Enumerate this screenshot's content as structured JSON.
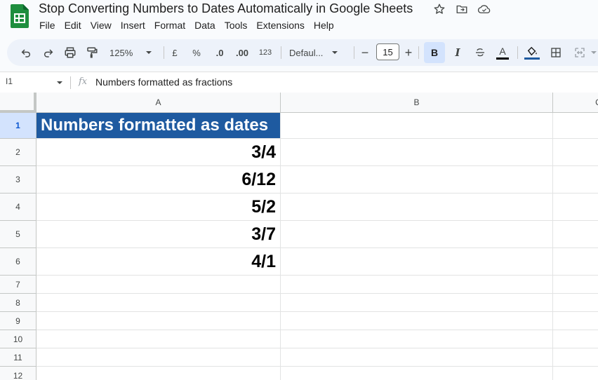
{
  "app": {
    "doc_title": "Stop Converting Numbers to Dates Automatically in Google Sheets",
    "brand_color": "#1e8e3e"
  },
  "menu": [
    "File",
    "Edit",
    "View",
    "Insert",
    "Format",
    "Data",
    "Tools",
    "Extensions",
    "Help"
  ],
  "toolbar": {
    "zoom": "125%",
    "currency": "£",
    "percent": "%",
    "decrease_decimals": ".0",
    "increase_decimals": ".00",
    "number_format": "123",
    "font": "Defaul...",
    "font_size": "15",
    "bold": "B",
    "italic": "I",
    "text_color": "A"
  },
  "formula_bar": {
    "cell_ref": "I1",
    "fx": "fx",
    "content": "Numbers formatted as fractions"
  },
  "columns": [
    "A",
    "B",
    "C"
  ],
  "rows": [
    "1",
    "2",
    "3",
    "4",
    "5",
    "6",
    "7",
    "8",
    "9",
    "10",
    "11",
    "12"
  ],
  "cells": {
    "a1": "Numbers formatted as dates",
    "a2": "3/4",
    "a3": "6/12",
    "a4": "5/2",
    "a5": "3/7",
    "a6": "4/1"
  },
  "colors": {
    "header_fill": "#1e5aa0",
    "toolbar_bg": "#edf2fa",
    "active_button": "#d3e3fd"
  }
}
